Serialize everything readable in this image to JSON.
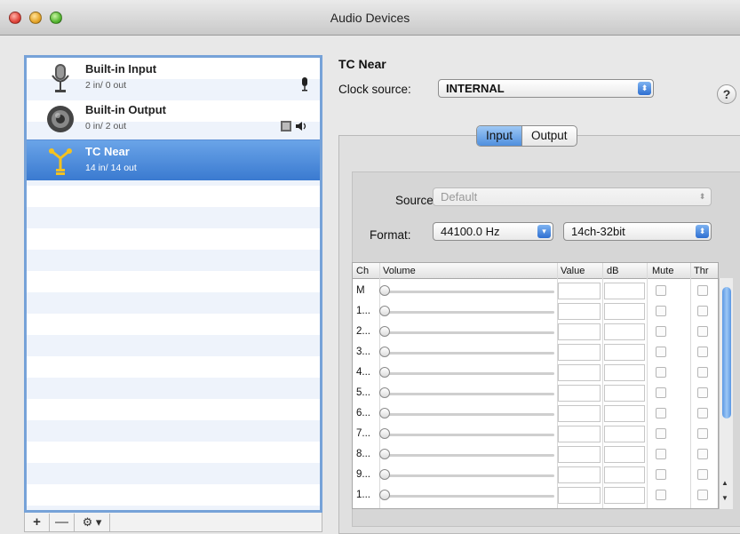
{
  "window": {
    "title": "Audio Devices"
  },
  "devices": [
    {
      "name": "Built-in Input",
      "io": "2 in/ 0 out",
      "icon": "microphone-icon",
      "tag": "🎙"
    },
    {
      "name": "Built-in Output",
      "io": "0 in/ 2 out",
      "icon": "speaker-icon",
      "tag": "▣ ◀)"
    },
    {
      "name": "TC Near",
      "io": "14 in/ 14 out",
      "icon": "firewire-icon",
      "tag": ""
    }
  ],
  "list_tools": {
    "add": "+",
    "remove": "—",
    "gear": "⚙ ▾"
  },
  "detail": {
    "device_title": "TC Near",
    "clock_label": "Clock source:",
    "clock_value": "INTERNAL",
    "help": "?",
    "tabs": {
      "input": "Input",
      "output": "Output"
    },
    "source_label": "Source:",
    "source_value": "Default",
    "format_label": "Format:",
    "format_rate": "44100.0 Hz",
    "format_bits": "14ch-32bit"
  },
  "table": {
    "headers": {
      "ch": "Ch",
      "volume": "Volume",
      "value": "Value",
      "db": "dB",
      "mute": "Mute",
      "thru": "Thr"
    },
    "rows": [
      "M",
      "1...",
      "2...",
      "3...",
      "4...",
      "5...",
      "6...",
      "7...",
      "8...",
      "9...",
      "1..."
    ]
  }
}
